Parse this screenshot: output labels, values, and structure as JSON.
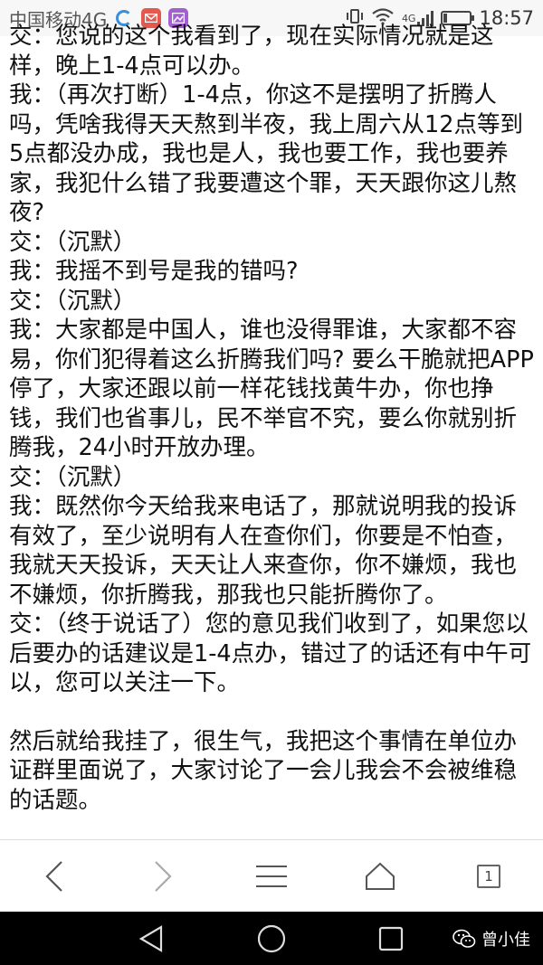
{
  "status_bar": {
    "carrier": "中国移动4G",
    "network": "4G",
    "time": "18:57"
  },
  "article": {
    "paragraphs": [
      "交：您说的这个我看到了，现在实际情况就是这样，晚上1-4点可以办。",
      "我：（再次打断）1-4点，你这不是摆明了折腾人吗，凭啥我得天天熬到半夜，我上周六从12点等到5点都没办成，我也是人，我也要工作，我也要养家，我犯什么错了我要遭这个罪，天天跟你这儿熬夜?",
      "交：（沉默）",
      "我：我摇不到号是我的错吗?",
      "交：（沉默）",
      "我：大家都是中国人，谁也没得罪谁，大家都不容易，你们犯得着这么折腾我们吗? 要么干脆就把APP停了，大家还跟以前一样花钱找黄牛办，你也挣钱，我们也省事儿，民不举官不究，要么你就别折腾我，24小时开放办理。",
      "交：（沉默）",
      "我：既然你今天给我来电话了，那就说明我的投诉有效了，至少说明有人在查你们，你要是不怕查，我就天天投诉，天天让人来查你，你不嫌烦，我也不嫌烦，你折腾我，那我也只能折腾你了。",
      "交：（终于说话了）您的意见我们收到了，如果您以后要办的话建议是1-4点办，错过了的话还有中午可以，您可以关注一下。",
      "然后就给我挂了，很生气，我把这个事情在单位办证群里面说了，大家讨论了一会儿我会不会被维稳的话题。"
    ]
  },
  "browser_toolbar": {
    "tab_count": "1"
  },
  "watermark": {
    "name": "曾小佳"
  }
}
